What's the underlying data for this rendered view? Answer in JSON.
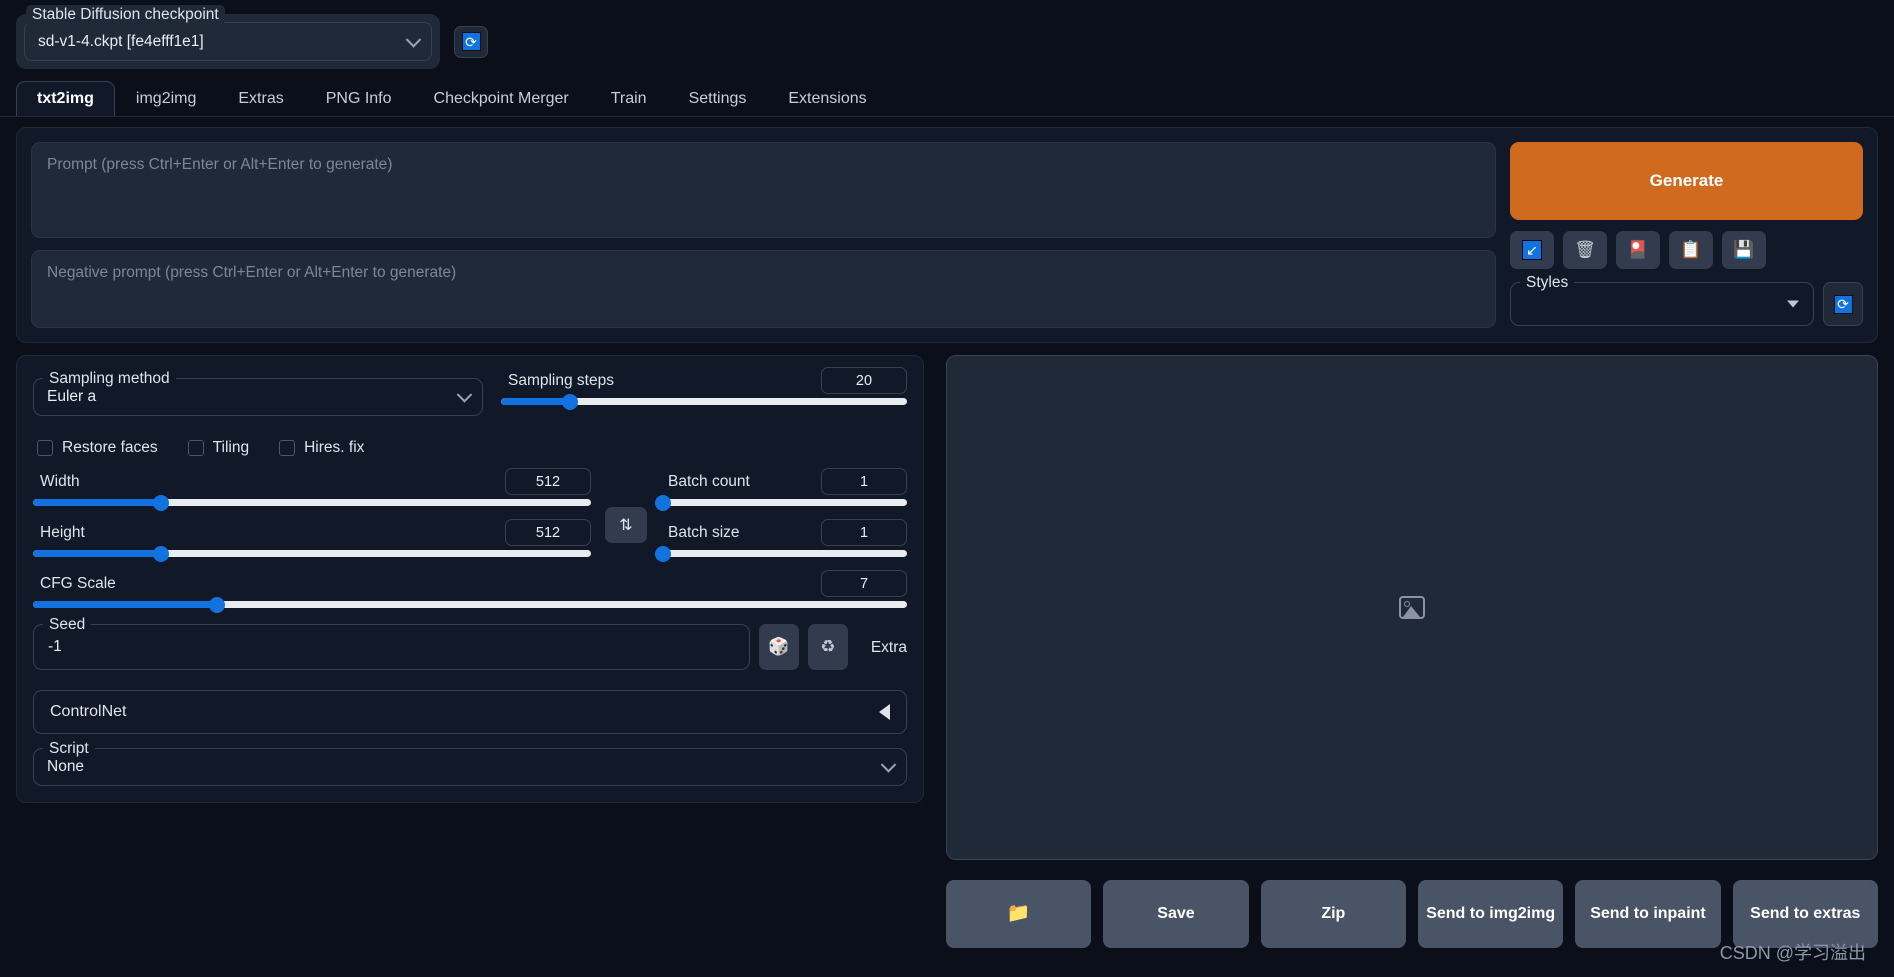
{
  "checkpoint": {
    "label": "Stable Diffusion checkpoint",
    "value": "sd-v1-4.ckpt [fe4efff1e1]",
    "refresh_icon": "refresh-icon",
    "refresh_glyph": "⟳"
  },
  "tabs": [
    {
      "label": "txt2img",
      "active": true
    },
    {
      "label": "img2img",
      "active": false
    },
    {
      "label": "Extras",
      "active": false
    },
    {
      "label": "PNG Info",
      "active": false
    },
    {
      "label": "Checkpoint Merger",
      "active": false
    },
    {
      "label": "Train",
      "active": false
    },
    {
      "label": "Settings",
      "active": false
    },
    {
      "label": "Extensions",
      "active": false
    }
  ],
  "prompt": {
    "placeholder": "Prompt (press Ctrl+Enter or Alt+Enter to generate)",
    "value": ""
  },
  "negative_prompt": {
    "placeholder": "Negative prompt (press Ctrl+Enter or Alt+Enter to generate)",
    "value": ""
  },
  "generate": {
    "label": "Generate",
    "color": "#cf6a1e"
  },
  "tool_buttons": [
    {
      "name": "restore-progress-icon",
      "glyph": "↙"
    },
    {
      "name": "trash-icon",
      "glyph": "🗑"
    },
    {
      "name": "red-card-icon",
      "glyph": "🎴"
    },
    {
      "name": "clipboard-icon",
      "glyph": "📋"
    },
    {
      "name": "save-style-icon",
      "glyph": "💾"
    }
  ],
  "styles": {
    "label": "Styles",
    "value": "",
    "refresh_glyph": "⟳"
  },
  "sampling_method": {
    "label": "Sampling method",
    "value": "Euler a"
  },
  "sampling_steps": {
    "label": "Sampling steps",
    "value": "20",
    "percent": 17
  },
  "checkboxes": [
    {
      "label": "Restore faces",
      "checked": false
    },
    {
      "label": "Tiling",
      "checked": false
    },
    {
      "label": "Hires. fix",
      "checked": false
    }
  ],
  "width": {
    "label": "Width",
    "value": "512",
    "percent": 23
  },
  "height": {
    "label": "Height",
    "value": "512",
    "percent": 23
  },
  "swap_button": {
    "name": "swap-dimensions-button",
    "glyph": "⇅"
  },
  "batch_count": {
    "label": "Batch count",
    "value": "1",
    "percent": 1
  },
  "batch_size": {
    "label": "Batch size",
    "value": "1",
    "percent": 1
  },
  "cfg_scale": {
    "label": "CFG Scale",
    "value": "7",
    "percent": 21
  },
  "seed": {
    "label": "Seed",
    "value": "-1",
    "dice_glyph": "🎲",
    "recycle_glyph": "♻",
    "extra_label": "Extra",
    "extra_checked": false
  },
  "controlnet": {
    "label": "ControlNet",
    "collapsed": true
  },
  "script": {
    "label": "Script",
    "value": "None"
  },
  "output": {
    "placeholder_icon": "image-placeholder-icon"
  },
  "output_actions": [
    {
      "label": "📁",
      "name": "open-folder-button"
    },
    {
      "label": "Save",
      "name": "save-button"
    },
    {
      "label": "Zip",
      "name": "zip-button"
    },
    {
      "label": "Send to img2img",
      "name": "send-to-img2img-button"
    },
    {
      "label": "Send to inpaint",
      "name": "send-to-inpaint-button"
    },
    {
      "label": "Send to extras",
      "name": "send-to-extras-button"
    }
  ],
  "watermark": "CSDN @学习溢出"
}
